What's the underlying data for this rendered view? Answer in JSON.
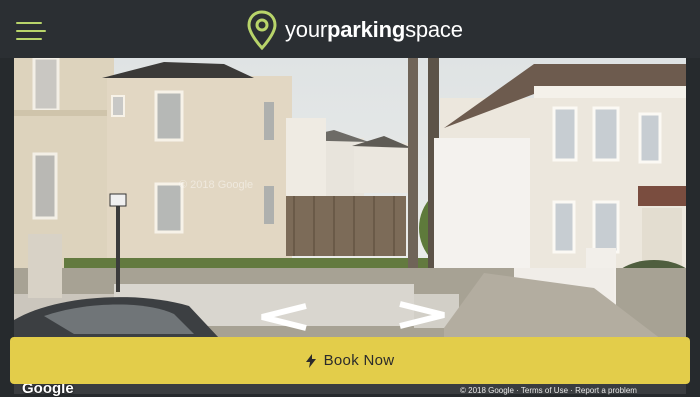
{
  "header": {
    "menu_icon": "hamburger-menu-icon",
    "logo_icon": "location-pin-icon",
    "logo_text_prefix": "your",
    "logo_text_bold": "parking",
    "logo_text_suffix": "space",
    "accent_color": "#b8d46a"
  },
  "street_view": {
    "watermark": "© 2018 Google",
    "google_mark": "Google",
    "copyright": "© 2018 Google · Terms of Use · Report a problem",
    "prev_icon": "chevron-left-icon",
    "next_icon": "chevron-right-icon"
  },
  "actions": {
    "book_now_label": "Book Now",
    "book_now_icon": "lightning-bolt-icon",
    "book_now_color": "#e3cd4a"
  }
}
